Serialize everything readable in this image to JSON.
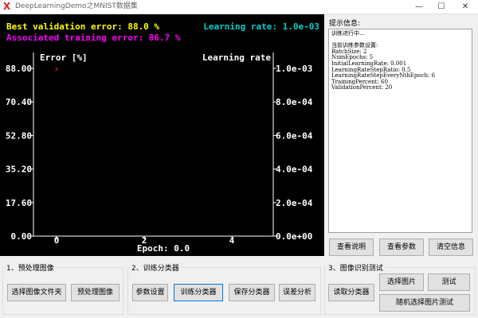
{
  "window": {
    "title": "DeepLearningDemo之MNIST数据集",
    "minimize": "—",
    "maximize": "☐",
    "close": "✕"
  },
  "plot": {
    "best_validation": "Best validation error: 88.0 %",
    "training_error": "Associated training error: 86.7 %",
    "learning_rate_header": "Learning rate: 1.0e-03",
    "left_axis_label": "Error [%]",
    "right_axis_label": "Learning rate",
    "x_axis_label": "Epoch: 0.0",
    "colors": {
      "best": "#ffff00",
      "training": "#ff00ff",
      "lr": "#00d0d0",
      "axis": "#ffffff",
      "marker": "#ff3030"
    }
  },
  "chart_data": {
    "type": "line",
    "title": "",
    "xlabel": "Epoch: 0.0",
    "ylabel": "Error [%]",
    "y2label": "Learning rate",
    "x_ticks": [
      "0",
      "2",
      "4"
    ],
    "y_ticks": [
      "0.00",
      "17.60",
      "35.20",
      "52.80",
      "70.40",
      "88.00"
    ],
    "y2_ticks": [
      "0.0e+00",
      "2.0e-04",
      "4.0e-04",
      "6.0e-04",
      "8.0e-04",
      "1.0e-03"
    ],
    "xlim": [
      0,
      5
    ],
    "ylim": [
      0,
      88
    ],
    "y2lim": [
      0,
      0.001
    ],
    "series": [
      {
        "name": "validation error",
        "x": [
          0
        ],
        "y": [
          88.0
        ]
      }
    ]
  },
  "info": {
    "label": "提示信息:",
    "lines": [
      "训练进行中...",
      "",
      "当前训练参数设置:",
      "BatchSize: 2",
      "NumEpochs: 5",
      "InitialLearningRate: 0.001",
      "LearningRateStepRatio: 0.5",
      "LearningRateStepEveryNthEpoch: 6",
      "TrainingPercent: 60",
      "ValidationPercent: 20"
    ],
    "buttons": {
      "help": "查看说明",
      "params": "查看参数",
      "clear": "清空信息"
    }
  },
  "groups": {
    "preprocess": {
      "title": "1、预处理图像",
      "select_folder": "选择图像文件夹",
      "preprocess": "预处理图像"
    },
    "train": {
      "title": "2、训练分类器",
      "param_settings": "参数设置",
      "train": "训练分类器",
      "save": "保存分类器",
      "error_analysis": "误差分析"
    },
    "test": {
      "title": "3、图像识别测试",
      "load_classifier": "读取分类器",
      "select_image": "选择图片",
      "test": "测试",
      "random_test": "随机选择图片测试"
    }
  }
}
